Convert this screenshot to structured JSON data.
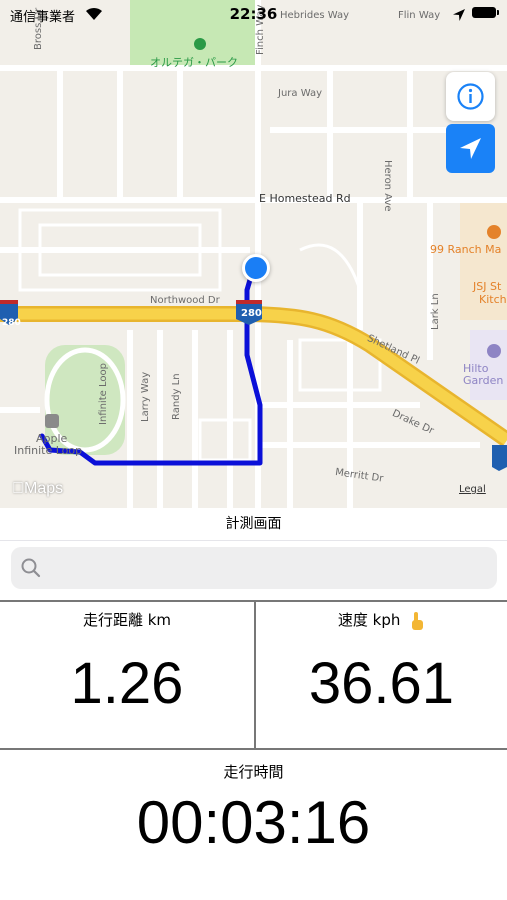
{
  "status_bar": {
    "carrier": "通信事業者",
    "time": "22:36"
  },
  "map": {
    "labels": {
      "park": "オルテガ・パーク",
      "hebrides_way": "Hebrides Way",
      "flin_way": "Flin Way",
      "jura_way": "Jura Way",
      "finch_way": "Finch Way",
      "heron_ave": "Heron Ave",
      "homestead_rd": "E Homestead Rd",
      "ranch_market": "99 Ranch Ma",
      "jsj": "JSJ St",
      "kitch": "Kitch",
      "northwood_dr": "Northwood Dr",
      "shetland_pl": "Shetland Pl",
      "lark_ln": "Lark Ln",
      "hilton": "Hilto",
      "garden": "Garden",
      "drake_dr": "Drake Dr",
      "merritt_dr": "Merritt Dr",
      "infinite_loop": "Infinite Loop",
      "larry_way": "Larry Way",
      "randy_ln": "Randy Ln",
      "apple": "Apple",
      "infinite_loop_poi": "Infinite Loop",
      "highway_shield_1": "280",
      "highway_shield_2": "280",
      "bross_dr": "Bross Dr"
    },
    "maps_logo": "Maps",
    "legal": "Legal",
    "route_color": "#0b10d8",
    "user_dot_color": "#1a7ef5",
    "highway_color": "#f7d24a"
  },
  "nav": {
    "title": "計測画面"
  },
  "search": {
    "placeholder": "",
    "value": ""
  },
  "metrics": {
    "distance_label": "走行距離 km",
    "distance_value": "1.26",
    "speed_label": "速度 kph",
    "speed_value": "36.61",
    "time_label": "走行時間",
    "time_value": "00:03:16"
  }
}
